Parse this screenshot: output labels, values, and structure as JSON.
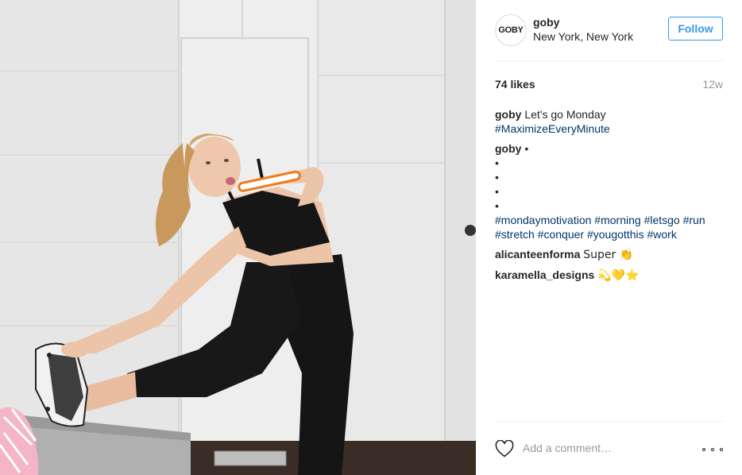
{
  "post": {
    "image_alt": "Woman in black sports bra and leggings stretching while brushing teeth"
  },
  "header": {
    "avatar_text": "GOBY",
    "username": "goby",
    "location": "New York, New York",
    "follow_label": "Follow"
  },
  "stats": {
    "likes": "74 likes",
    "time": "12w"
  },
  "caption": {
    "author": "goby",
    "text": "Let's go Monday",
    "tag": "#MaximizeEveryMinute"
  },
  "comment1": {
    "author": "goby",
    "first_bullet": " •",
    "bullets": [
      "•",
      "•",
      "•",
      "•"
    ],
    "tags": [
      "#mondaymotivation",
      "#morning",
      "#letsgo",
      "#run",
      "#stretch",
      "#conquer",
      "#yougotthis",
      "#work"
    ]
  },
  "comment2": {
    "author": "alicanteenforma",
    "text": "Super 👏"
  },
  "comment3": {
    "author": "karamella_designs",
    "text": "💫💛⭐"
  },
  "footer": {
    "comment_placeholder": "Add a comment…"
  },
  "icons": {
    "like": "heart-icon",
    "more": "more-options-icon"
  }
}
